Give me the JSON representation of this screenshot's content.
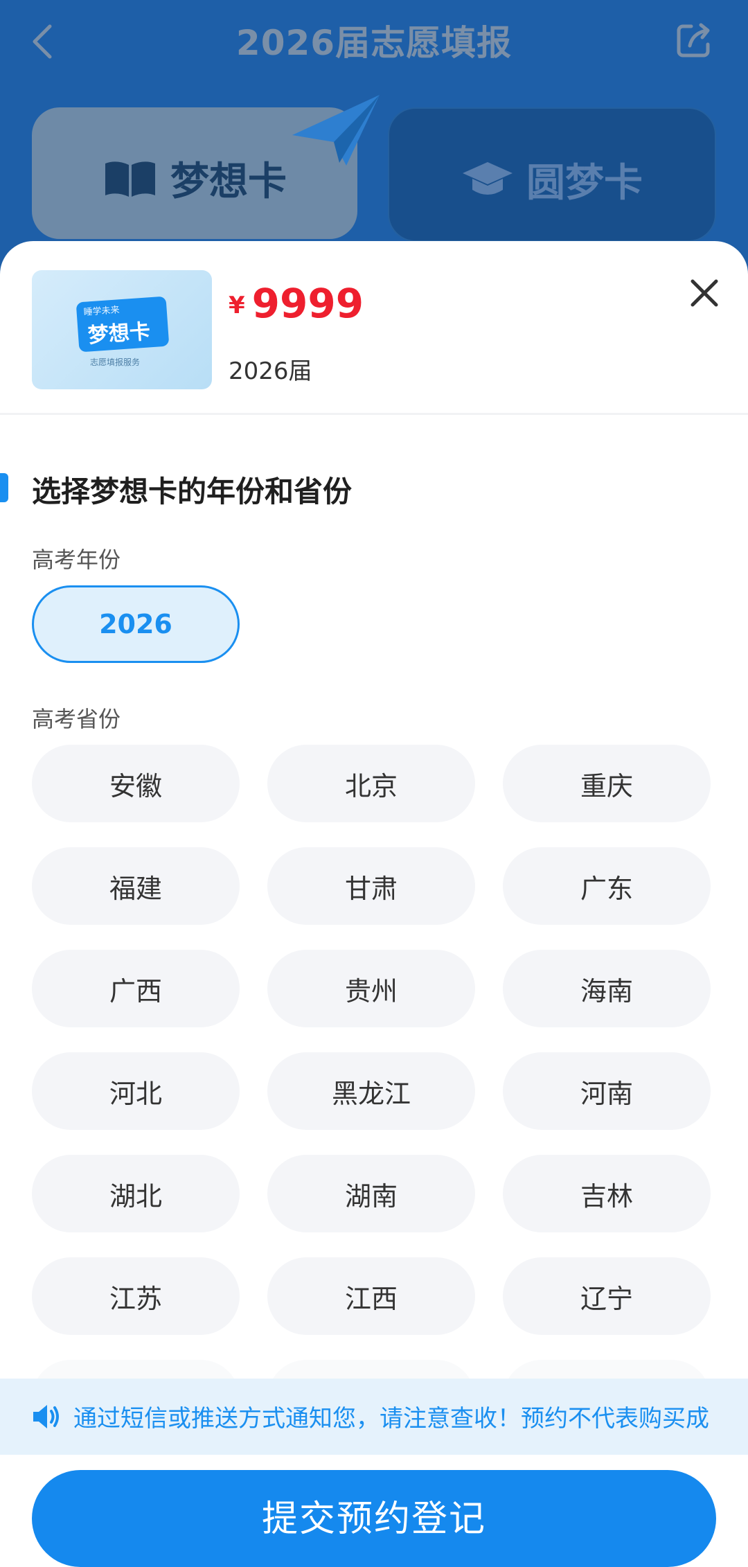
{
  "header": {
    "title": "2026届志愿填报"
  },
  "tabs": [
    {
      "label": "梦想卡",
      "icon": "book-icon",
      "active": true
    },
    {
      "label": "圆梦卡",
      "icon": "graduation-cap-icon",
      "active": false
    }
  ],
  "product": {
    "thumb_top": "睡学未来",
    "thumb_main": "梦想卡",
    "thumb_sub": "志愿填报服务",
    "price_symbol": "¥",
    "price": "9999",
    "grade": "2026届"
  },
  "section": {
    "title": "选择梦想卡的年份和省份"
  },
  "year": {
    "label": "高考年份",
    "options": [
      "2026"
    ],
    "selected": "2026"
  },
  "province": {
    "label": "高考省份",
    "options": [
      "安徽",
      "北京",
      "重庆",
      "福建",
      "甘肃",
      "广东",
      "广西",
      "贵州",
      "海南",
      "河北",
      "黑龙江",
      "河南",
      "湖北",
      "湖南",
      "吉林",
      "江苏",
      "江西",
      "辽宁"
    ]
  },
  "notice": {
    "icon": "speaker-icon",
    "text": "通过短信或推送方式通知您，请注意查收！预约不代表购买成"
  },
  "submit": {
    "label": "提交预约登记"
  },
  "colors": {
    "accent": "#1a8ff0",
    "price": "#ee1f2e",
    "header_bg": "#1e5fa8"
  }
}
